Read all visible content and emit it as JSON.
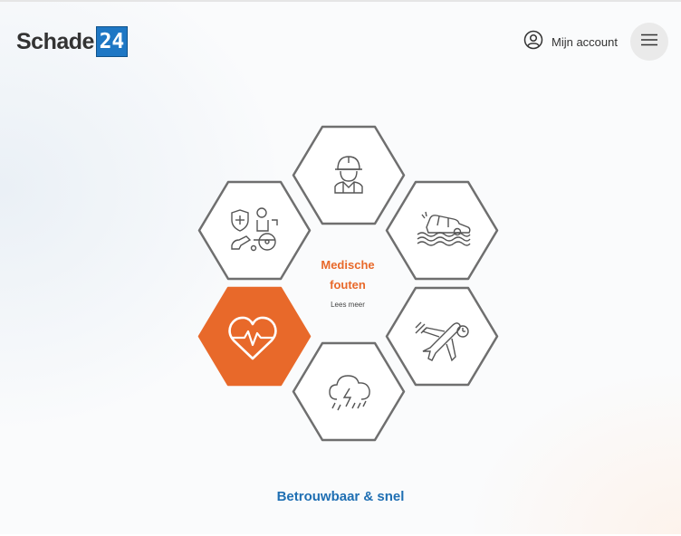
{
  "brand": {
    "logo_text": "Schade",
    "logo_number": "24",
    "logo_color": "#1e77c4"
  },
  "header": {
    "account_label": "Mijn account",
    "account_icon": "user-circle-icon",
    "menu_icon": "hamburger-menu-icon"
  },
  "categories": [
    {
      "name": "bouw",
      "icon": "construction-worker-icon",
      "active": false
    },
    {
      "name": "verkeer",
      "icon": "car-flood-icon",
      "active": false
    },
    {
      "name": "reizen",
      "icon": "airplane-icon",
      "active": false
    },
    {
      "name": "weer",
      "icon": "storm-cloud-icon",
      "active": false
    },
    {
      "name": "medisch",
      "icon": "heartbeat-icon",
      "active": true
    },
    {
      "name": "letsel",
      "icon": "wheelchair-shield-icon",
      "active": false
    }
  ],
  "selected": {
    "title": "Medische\nfouten",
    "link": "Lees meer"
  },
  "tagline": "Betrouwbaar & snel",
  "colors": {
    "accent": "#e8692a",
    "hex_stroke": "#6f6f6f",
    "tagline": "#1f6fb3"
  }
}
